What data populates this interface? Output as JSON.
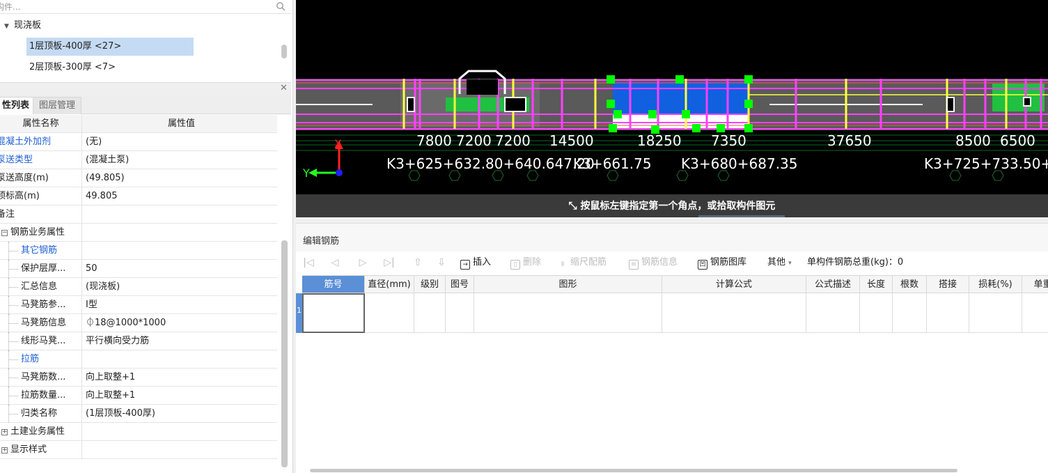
{
  "search": {
    "placeholder": "构件..."
  },
  "tree": {
    "group": "现浇板",
    "items": [
      {
        "label": "1层顶板-400厚 <27>",
        "selected": true
      },
      {
        "label": "2层顶板-300厚 <7>",
        "selected": false
      }
    ]
  },
  "tabs": [
    {
      "label": "性列表",
      "active": true
    },
    {
      "label": "图层管理",
      "active": false
    }
  ],
  "props": {
    "header": {
      "name": "属性名称",
      "value": "属性值"
    },
    "rows": [
      {
        "name": "混凝土外加剂",
        "value": "(无)",
        "style": "blue"
      },
      {
        "name": "泵送类型",
        "value": "(混凝土泵)",
        "style": "blue"
      },
      {
        "name": "泵送高度(m)",
        "value": "(49.805)",
        "style": "plain"
      },
      {
        "name": "顶标高(m)",
        "value": "49.805",
        "style": "plain"
      },
      {
        "name": "备注",
        "value": "",
        "style": "plain"
      },
      {
        "name": "钢筋业务属性",
        "value": "",
        "style": "group",
        "toggle": "−"
      },
      {
        "name": "其它钢筋",
        "value": "",
        "style": "child-blue"
      },
      {
        "name": "保护层厚...",
        "value": "50",
        "style": "child"
      },
      {
        "name": "汇总信息",
        "value": "(现浇板)",
        "style": "child"
      },
      {
        "name": "马凳筋参...",
        "value": "Ⅰ型",
        "style": "child"
      },
      {
        "name": "马凳筋信息",
        "value": "⏀18@1000*1000",
        "style": "child"
      },
      {
        "name": "线形马凳...",
        "value": "平行横向受力筋",
        "style": "child"
      },
      {
        "name": "拉筋",
        "value": "",
        "style": "child-blue"
      },
      {
        "name": "马凳筋数...",
        "value": "向上取整+1",
        "style": "child"
      },
      {
        "name": "拉筋数量...",
        "value": "向上取整+1",
        "style": "child"
      },
      {
        "name": "归类名称",
        "value": "(1层顶板-400厚)",
        "style": "child"
      },
      {
        "name": "土建业务属性",
        "value": "",
        "style": "group",
        "toggle": "+"
      },
      {
        "name": "显示样式",
        "value": "",
        "style": "group",
        "toggle": "+"
      }
    ]
  },
  "canvas": {
    "dimensions": [
      "7800",
      "7200",
      "7200",
      "14500",
      "18250",
      "7350",
      "37650",
      "8500",
      "6500"
    ],
    "stations": [
      "K3+625+632.80+640.647.20",
      "K3+661.75",
      "K3+680+687.35",
      "K3+725+733.50+74"
    ],
    "axis_x": "X",
    "axis_y": "Y"
  },
  "status": {
    "message": "按鼠标左键指定第一个角点，或拾取构件图元"
  },
  "editor": {
    "title": "编辑钢筋",
    "toolbar": {
      "insert": "插入",
      "delete": "删除",
      "scale": "缩尺配筋",
      "rebar_info": "钢筋信息",
      "rebar_lib": "钢筋图库",
      "other": "其他",
      "total_weight": "单构件钢筋总重(kg)：0"
    },
    "columns": [
      "筋号",
      "直径(mm)",
      "级别",
      "图号",
      "图形",
      "计算公式",
      "公式描述",
      "长度",
      "根数",
      "搭接",
      "损耗(%)",
      "单重"
    ],
    "rows": [
      {
        "num": "1"
      }
    ]
  },
  "colors": {
    "canvas_bg": "#000000",
    "selection_blue": "#5b8fd6",
    "link_blue": "#1f5fd0",
    "grip_green": "#00ff00",
    "magenta": "#ff40ff",
    "yellow": "#ffff40"
  }
}
